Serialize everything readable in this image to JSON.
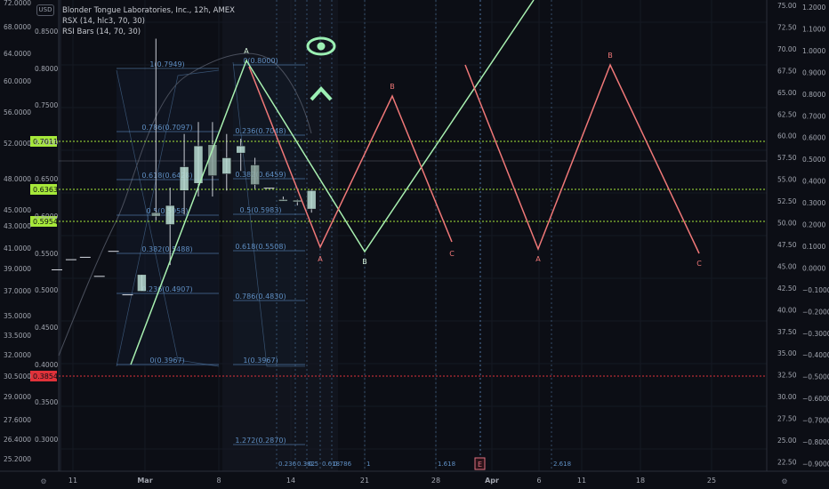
{
  "legend": {
    "symbol_line": "Blonder Tongue Laboratories, Inc., 12h, AMEX",
    "rsx_line": "RSX (14, hlc3, 70, 30)",
    "rsibars_line": "RSI Bars (14, 70, 30)"
  },
  "currency_button": "USD",
  "bottom_icons": {
    "left": "⚙",
    "right": "⚙"
  },
  "colors": {
    "background": "#0c0e15",
    "up_candle": "#b8dcd2",
    "down_candle": "#b8dcd2",
    "green_pattern": "#a8f0b0",
    "red_pattern": "#f07878",
    "fib": "#5f8fc4",
    "dotted_green": "#a6e83a",
    "dotted_red": "#e0323a",
    "eye_icon": "#9cf0b4"
  },
  "chart_data": {
    "type": "candlestick",
    "title": "Blonder Tongue Laboratories, Inc., 12h, AMEX",
    "left_axis": {
      "scale": "log",
      "ticks": [
        "72.0000",
        "68.0000",
        "64.0000",
        "60.0000",
        "56.0000",
        "52.0000",
        "48.0000",
        "45.0000",
        "43.0000",
        "41.0000",
        "39.0000",
        "37.0000",
        "35.0000",
        "33.5000",
        "32.0000",
        "30.5000",
        "29.0000",
        "27.6000",
        "26.4000",
        "25.2000"
      ]
    },
    "left_inner_axis": {
      "ticks": [
        "0.8500",
        "0.8000",
        "0.7500",
        "0.7000",
        "0.6500",
        "0.6000",
        "0.5500",
        "0.5000",
        "0.4500",
        "0.4000",
        "0.3500",
        "0.3000"
      ]
    },
    "right_axis_1": {
      "ticks": [
        "75.00",
        "72.50",
        "70.00",
        "67.50",
        "65.00",
        "62.50",
        "60.00",
        "57.50",
        "55.00",
        "52.50",
        "50.00",
        "47.50",
        "45.00",
        "42.50",
        "40.00",
        "37.50",
        "35.00",
        "32.50",
        "30.00",
        "27.50",
        "25.00",
        "22.50"
      ]
    },
    "right_axis_2": {
      "ticks": [
        "1.2000",
        "1.1000",
        "1.0000",
        "0.9000",
        "0.8000",
        "0.7000",
        "0.6000",
        "0.5000",
        "0.4000",
        "0.3000",
        "0.2000",
        "0.1000",
        "0.0000",
        "−0.1000",
        "−0.2000",
        "−0.3000",
        "−0.4000",
        "−0.5000",
        "−0.6000",
        "−0.7000",
        "−0.8000",
        "−0.9000"
      ]
    },
    "x_axis_ticks": [
      "11",
      "Mar",
      "8",
      "14",
      "21",
      "28",
      "Apr",
      "6",
      "11",
      "18",
      "25"
    ],
    "price_labels": [
      {
        "value": "0.7011",
        "color": "#a6e83a"
      },
      {
        "value": "0.6363",
        "color": "#a6e83a"
      },
      {
        "value": "0.5954",
        "color": "#a6e83a"
      },
      {
        "value": "0.3854",
        "color": "#e0323a"
      }
    ],
    "candles": [
      {
        "o": 0.462,
        "h": 0.462,
        "l": 0.462,
        "c": 0.462
      },
      {
        "o": 0.479,
        "h": 0.479,
        "l": 0.479,
        "c": 0.479
      },
      {
        "o": 0.483,
        "h": 0.483,
        "l": 0.483,
        "c": 0.483
      },
      {
        "o": 0.451,
        "h": 0.451,
        "l": 0.451,
        "c": 0.451
      },
      {
        "o": 0.493,
        "h": 0.493,
        "l": 0.493,
        "c": 0.493
      },
      {
        "o": 0.42,
        "h": 0.42,
        "l": 0.42,
        "c": 0.42
      },
      {
        "o": 0.426,
        "h": 0.454,
        "l": 0.426,
        "c": 0.454
      },
      {
        "o": 0.558,
        "h": 0.85,
        "l": 0.545,
        "c": 0.552
      },
      {
        "o": 0.538,
        "h": 0.6,
        "l": 0.47,
        "c": 0.57
      },
      {
        "o": 0.595,
        "h": 0.69,
        "l": 0.555,
        "c": 0.635
      },
      {
        "o": 0.607,
        "h": 0.71,
        "l": 0.585,
        "c": 0.67
      },
      {
        "o": 0.672,
        "h": 0.71,
        "l": 0.585,
        "c": 0.62
      },
      {
        "o": 0.623,
        "h": 0.69,
        "l": 0.595,
        "c": 0.65
      },
      {
        "o": 0.658,
        "h": 0.682,
        "l": 0.628,
        "c": 0.67
      },
      {
        "o": 0.638,
        "h": 0.65,
        "l": 0.598,
        "c": 0.605
      },
      {
        "o": 0.599,
        "h": 0.599,
        "l": 0.599,
        "c": 0.599
      },
      {
        "o": 0.58,
        "h": 0.585,
        "l": 0.578,
        "c": 0.579
      },
      {
        "o": 0.579,
        "h": 0.58,
        "l": 0.57,
        "c": 0.576
      },
      {
        "o": 0.564,
        "h": 0.597,
        "l": 0.558,
        "c": 0.595
      }
    ],
    "fib_levels_left": [
      {
        "label": "1(0.7949)"
      },
      {
        "label": "0.786(0.7097)"
      },
      {
        "label": "0.618(0.6428)"
      },
      {
        "label": "0.5(0.5958)"
      },
      {
        "label": "0.382(0.5488)"
      },
      {
        "label": "0.236(0.4907)"
      },
      {
        "label": "0(0.3967)"
      }
    ],
    "fib_levels_right": [
      {
        "label": "0(0.8000)"
      },
      {
        "label": "0.236(0.7048)"
      },
      {
        "label": "0.382(0.6459)"
      },
      {
        "label": "0.5(0.5983)"
      },
      {
        "label": "0.618(0.5508)"
      },
      {
        "label": "0.786(0.4830)"
      },
      {
        "label": "1(0.3967)"
      },
      {
        "label": "1.272(0.2870)"
      }
    ],
    "time_fib_labels": [
      "0.236",
      "0.382",
      "0.5",
      "0.618",
      "0.786",
      "1",
      "1.618",
      "2.618"
    ],
    "pattern_labels": {
      "green": [
        "A",
        "B"
      ],
      "red_1": [
        "B",
        "A",
        "C"
      ],
      "red_2": [
        "B",
        "A",
        "C"
      ]
    },
    "event_marker": "E"
  }
}
